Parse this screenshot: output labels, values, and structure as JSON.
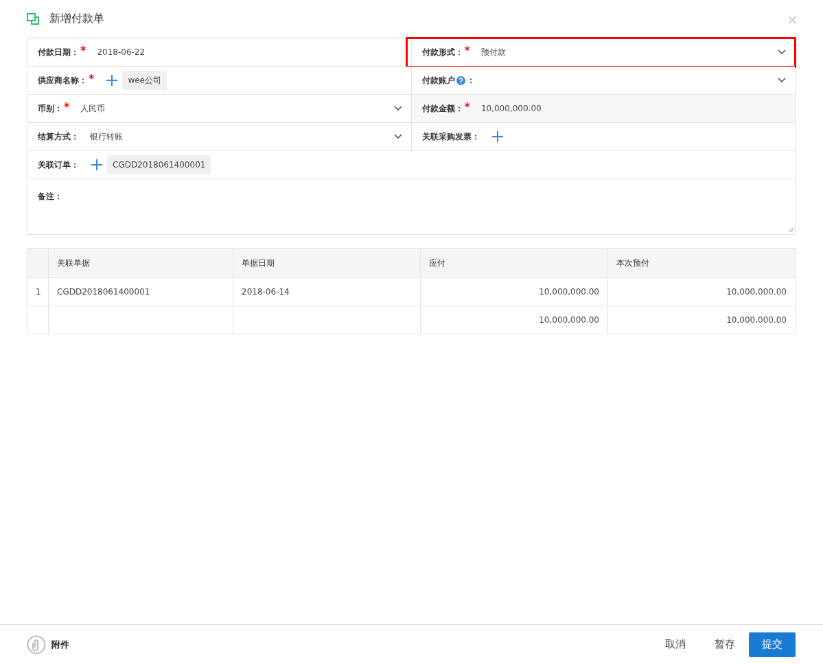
{
  "dialog": {
    "title": "新增付款单",
    "close": "×"
  },
  "form": {
    "rows": [
      {
        "fields": [
          {
            "kind": "text",
            "label": "付款日期：",
            "required_mark": "*",
            "value": "2018-06-22",
            "highlighted": false
          },
          {
            "kind": "select",
            "label": "付款形式：",
            "required_mark": "*",
            "value": "预付款",
            "highlighted": true
          }
        ]
      },
      {
        "fields": [
          {
            "kind": "add",
            "label": "供应商名称：",
            "required_mark": "*",
            "chips": [
              "wee公司"
            ],
            "highlighted": false
          },
          {
            "kind": "select",
            "label": "付款账户",
            "help": true,
            "suffix": "：",
            "highlighted": false
          }
        ]
      },
      {
        "fields": [
          {
            "kind": "select",
            "label": "币别：",
            "required_mark": "*",
            "value": "人民币",
            "highlighted": false
          },
          {
            "kind": "readonly",
            "label": "付款金额：",
            "required_mark": "*",
            "value": "10,000,000.00",
            "highlighted": false
          }
        ]
      },
      {
        "fields": [
          {
            "kind": "select",
            "label": "结算方式：",
            "value": "银行转账",
            "highlighted": false
          },
          {
            "kind": "add",
            "label": "关联采购发票：",
            "highlighted": false
          }
        ]
      },
      {
        "fields": [
          {
            "kind": "add",
            "label": "关联订单：",
            "chips": [
              "CGDD2018061400001"
            ],
            "highlighted": false
          }
        ]
      }
    ],
    "remarks": {
      "label": "备注："
    }
  },
  "table": {
    "columns": [
      {
        "title": "关联单据"
      },
      {
        "title": "单据日期"
      },
      {
        "title": "应付"
      },
      {
        "title": "本次预付"
      }
    ],
    "rows": [
      {
        "index": "1",
        "cells": [
          {
            "text": "CGDD2018061400001"
          },
          {
            "text": "2018-06-14"
          },
          {
            "text": "10,000,000.00"
          },
          {
            "text": "10,000,000.00"
          }
        ]
      },
      {
        "cells": [
          null,
          null,
          {
            "text": "10,000,000.00"
          },
          {
            "text": "10,000,000.00"
          }
        ]
      }
    ]
  },
  "footer": {
    "attachment": "附件",
    "buttons": [
      {
        "label": "取消",
        "kind": "plain"
      },
      {
        "label": "暂存",
        "kind": "plain"
      },
      {
        "label": "提交",
        "kind": "primary"
      }
    ]
  }
}
